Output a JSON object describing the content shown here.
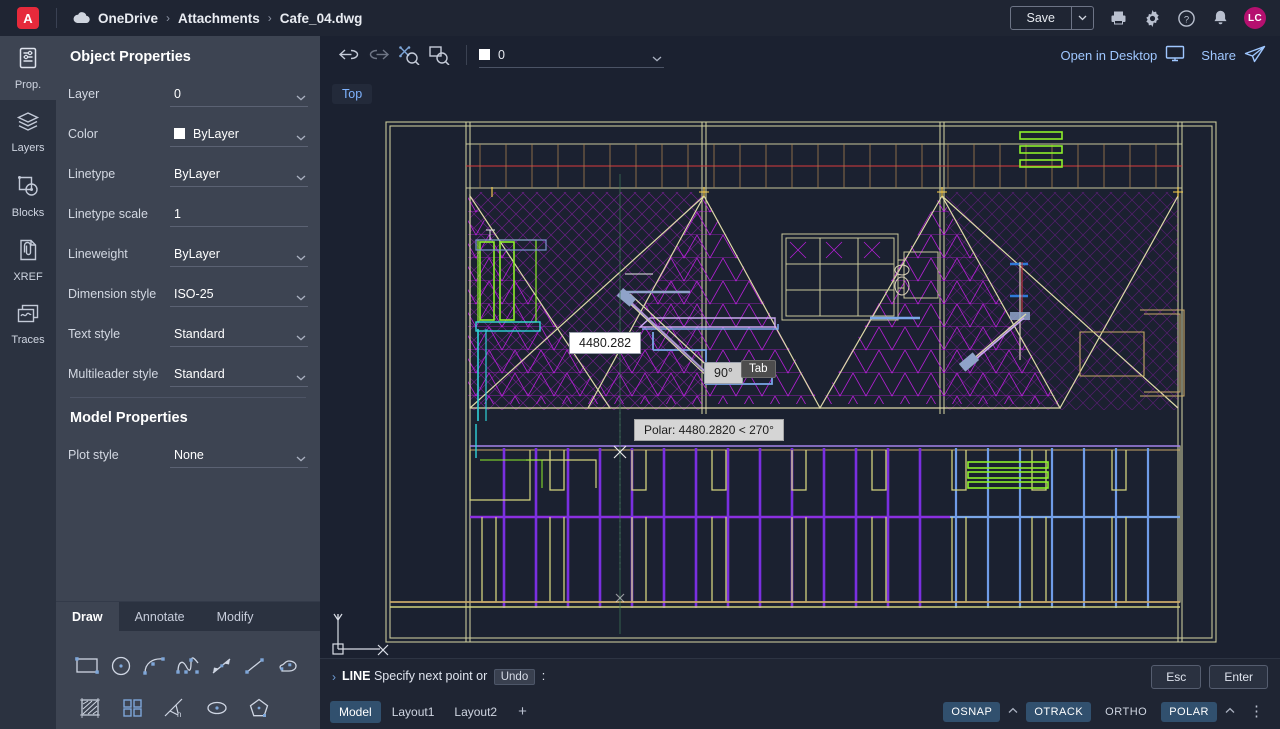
{
  "header": {
    "logo_text": "A",
    "breadcrumb": [
      "OneDrive",
      "Attachments",
      "Cafe_04.dwg"
    ],
    "separator": "›",
    "save_label": "Save",
    "icons": [
      "print-icon",
      "gear-icon",
      "help-icon",
      "bell-icon"
    ],
    "avatar_initials": "LC"
  },
  "rail": {
    "items": [
      {
        "label": "Prop.",
        "icon": "properties-icon",
        "active": true
      },
      {
        "label": "Layers",
        "icon": "layers-icon",
        "active": false
      },
      {
        "label": "Blocks",
        "icon": "blocks-icon",
        "active": false
      },
      {
        "label": "XREF",
        "icon": "xref-icon",
        "active": false
      },
      {
        "label": "Traces",
        "icon": "traces-icon",
        "active": false
      }
    ]
  },
  "panel": {
    "object_title": "Object Properties",
    "object_rows": [
      {
        "label": "Layer",
        "value": "0",
        "swatch": false,
        "caret": true
      },
      {
        "label": "Color",
        "value": "ByLayer",
        "swatch": true,
        "caret": true
      },
      {
        "label": "Linetype",
        "value": "ByLayer",
        "swatch": false,
        "caret": true
      },
      {
        "label": "Linetype scale",
        "value": "1",
        "swatch": false,
        "caret": false
      },
      {
        "label": "Lineweight",
        "value": "ByLayer",
        "swatch": false,
        "caret": true
      },
      {
        "label": "Dimension style",
        "value": "ISO-25",
        "swatch": false,
        "caret": true
      },
      {
        "label": "Text style",
        "value": "Standard",
        "swatch": false,
        "caret": true
      },
      {
        "label": "Multileader style",
        "value": "Standard",
        "swatch": false,
        "caret": true
      }
    ],
    "model_title": "Model Properties",
    "model_rows": [
      {
        "label": "Plot style",
        "value": "None",
        "swatch": false,
        "caret": true
      }
    ],
    "swatch_color": "#ffffff"
  },
  "tools": {
    "tabs": [
      {
        "label": "Draw",
        "active": true
      },
      {
        "label": "Annotate",
        "active": false
      },
      {
        "label": "Modify",
        "active": false
      }
    ],
    "row1": [
      "rectangle-icon",
      "circle-icon",
      "arc-icon",
      "spline-icon",
      "polyline-icon",
      "line-icon",
      "revision-cloud-icon"
    ],
    "row2": [
      "hatch-icon",
      "array-icon",
      "construction-line-icon",
      "ellipse-icon",
      "polygon-icon"
    ]
  },
  "canvas_toolbar": {
    "undo": "undo-icon",
    "redo": "redo-icon",
    "zoom_extents": "zoom-extents-icon",
    "zoom_window": "zoom-window-icon",
    "layer_value": "0",
    "layer_swatch": "#ffffff",
    "open_in_desktop": "Open in Desktop",
    "share": "Share"
  },
  "viewport": {
    "view_label": "Top",
    "background": "#1b2130",
    "dyn_distance": "4480.282",
    "dyn_angle": "90°",
    "tab_hint": "Tab",
    "polar_tooltip": "Polar: 4480.2820 < 270°",
    "ucs_x_label": "X",
    "ucs_y_label": "Y"
  },
  "command_line": {
    "prompt_caret": "›",
    "command": "LINE",
    "text": "Specify next point or",
    "option": "Undo",
    "colon": ":",
    "esc_label": "Esc",
    "enter_label": "Enter"
  },
  "status_bar": {
    "layout_tabs": [
      {
        "label": "Model",
        "active": true
      },
      {
        "label": "Layout1",
        "active": false
      },
      {
        "label": "Layout2",
        "active": false
      }
    ],
    "add_tab": "+",
    "toggles": [
      {
        "label": "OSNAP",
        "on": true,
        "caret": true
      },
      {
        "label": "OTRACK",
        "on": true,
        "caret": false
      },
      {
        "label": "ORTHO",
        "on": false,
        "caret": false
      },
      {
        "label": "POLAR",
        "on": true,
        "caret": true
      }
    ],
    "kebab": "⋮"
  }
}
